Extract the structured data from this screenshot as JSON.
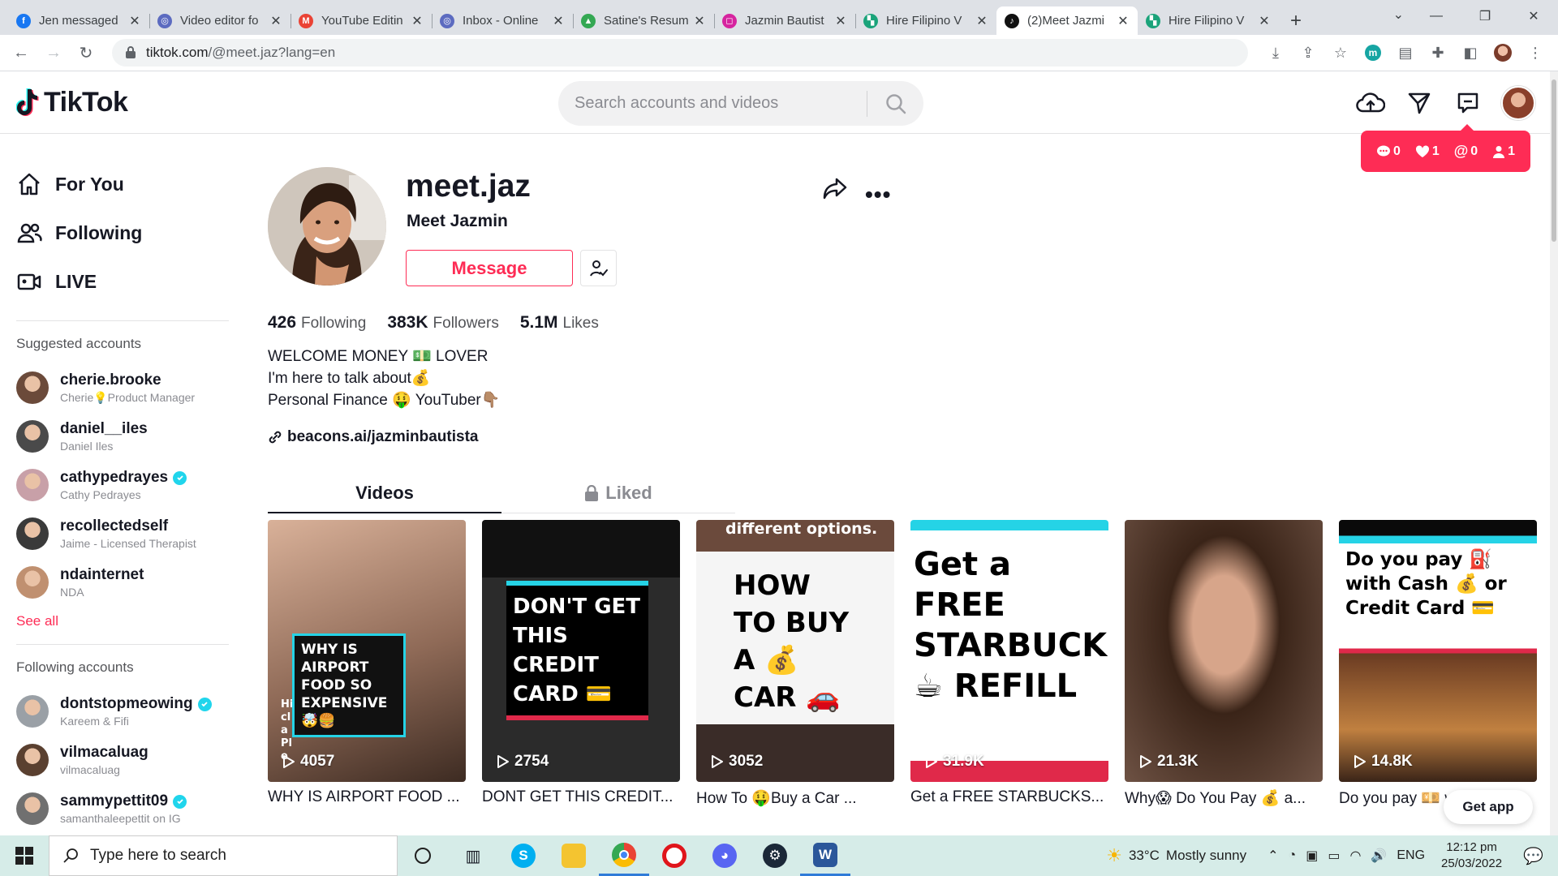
{
  "browser": {
    "tabs": [
      {
        "title": "Jen messaged",
        "color": "#1877f2",
        "glyph": "f"
      },
      {
        "title": "Video editor fo",
        "color": "#5c6bc0",
        "glyph": "◎"
      },
      {
        "title": "YouTube Editin",
        "color": "#ea4335",
        "glyph": "M"
      },
      {
        "title": "Inbox - Online",
        "color": "#5c6bc0",
        "glyph": "◎"
      },
      {
        "title": "Satine's Resum",
        "color": "#34a853",
        "glyph": "▲"
      },
      {
        "title": "Jazmin Bautist",
        "color": "#d6249f",
        "glyph": "◻"
      },
      {
        "title": "Hire Filipino V",
        "color": "#1aa37a",
        "glyph": "▚"
      },
      {
        "title": "(2)Meet Jazmi",
        "color": "#111111",
        "glyph": "♪"
      },
      {
        "title": "Hire Filipino V",
        "color": "#1aa37a",
        "glyph": "▚"
      }
    ],
    "active_tab": 7,
    "url_host": "tiktok.com",
    "url_path": "/@meet.jaz?lang=en"
  },
  "header": {
    "logo": "TikTok",
    "search_placeholder": "Search accounts and videos"
  },
  "notifications": {
    "comments": "0",
    "likes": "1",
    "mentions": "0",
    "followers": "1"
  },
  "sidebar": {
    "nav": [
      {
        "label": "For You",
        "icon": "home-icon"
      },
      {
        "label": "Following",
        "icon": "following-icon"
      },
      {
        "label": "LIVE",
        "icon": "live-icon"
      }
    ],
    "suggested_title": "Suggested accounts",
    "suggested": [
      {
        "handle": "cherie.brooke",
        "sub": "Cherie💡Product Manager",
        "verified": false,
        "color": "#6b4a3a"
      },
      {
        "handle": "daniel__iles",
        "sub": "Daniel Iles",
        "verified": false,
        "color": "#4a4a4a"
      },
      {
        "handle": "cathypedrayes",
        "sub": "Cathy Pedrayes",
        "verified": true,
        "color": "#c8a0a8"
      },
      {
        "handle": "recollectedself",
        "sub": "Jaime - Licensed Therapist",
        "verified": false,
        "color": "#3a3a3a"
      },
      {
        "handle": "ndainternet",
        "sub": "NDA",
        "verified": false,
        "color": "#c09070"
      }
    ],
    "see_all": "See all",
    "following_title": "Following accounts",
    "following": [
      {
        "handle": "dontstopmeowing",
        "sub": "Kareem & Fifi",
        "verified": true,
        "color": "#9aa0a6"
      },
      {
        "handle": "vilmacaluag",
        "sub": "vilmacaluag",
        "verified": false,
        "color": "#5a4030"
      },
      {
        "handle": "sammypettit09",
        "sub": "samanthaleepettit on IG",
        "verified": true,
        "color": "#707070"
      }
    ]
  },
  "profile": {
    "username": "meet.jaz",
    "display_name": "Meet Jazmin",
    "message_label": "Message",
    "following_count": "426",
    "following_label": "Following",
    "followers_count": "383K",
    "followers_label": "Followers",
    "likes_count": "5.1M",
    "likes_label": "Likes",
    "bio_line1": "WELCOME MONEY 💵 LOVER",
    "bio_line2": "I'm here to talk about💰",
    "bio_line3": "Personal Finance 🤑 YouTuber👇🏽",
    "link": "beacons.ai/jazminbautista",
    "tab_videos": "Videos",
    "tab_liked": "Liked"
  },
  "videos": [
    {
      "views": "4057",
      "caption": "WHY IS AIRPORT FOOD ...",
      "overlay": "WHY IS AIRPORT FOOD SO EXPENSIVE 🤯🍔",
      "overlay_top": "",
      "overlay_side": "Hi cla Ple"
    },
    {
      "views": "2754",
      "caption": "DONT GET THIS CREDIT...",
      "overlay": "DON'T GET THIS CREDIT CARD 💳",
      "overlay_top": "",
      "overlay_side": ""
    },
    {
      "views": "3052",
      "caption": "How To 🤑Buy a Car ...",
      "overlay": "HOW TO BUY A 💰 CAR 🚗",
      "overlay_top": "different options.",
      "overlay_side": ""
    },
    {
      "views": "31.9K",
      "caption": "Get a FREE STARBUCKS...",
      "overlay": "Get a FREE STARBUCKS ☕ REFILL",
      "overlay_top": "",
      "overlay_side": ""
    },
    {
      "views": "21.3K",
      "caption": "Why😱 Do You Pay 💰 a...",
      "overlay": "",
      "overlay_top": "",
      "overlay_side": ""
    },
    {
      "views": "14.8K",
      "caption": "Do you pay 💴 with Cas...",
      "overlay": "Do you pay ⛽ with Cash 💰 or Credit Card 💳",
      "overlay_top": "",
      "overlay_side": ""
    }
  ],
  "get_app": "Get app",
  "taskbar": {
    "search_placeholder": "Type here to search",
    "temperature": "33°C",
    "weather": "Mostly sunny",
    "language": "ENG",
    "time": "12:12 pm",
    "date": "25/03/2022"
  }
}
